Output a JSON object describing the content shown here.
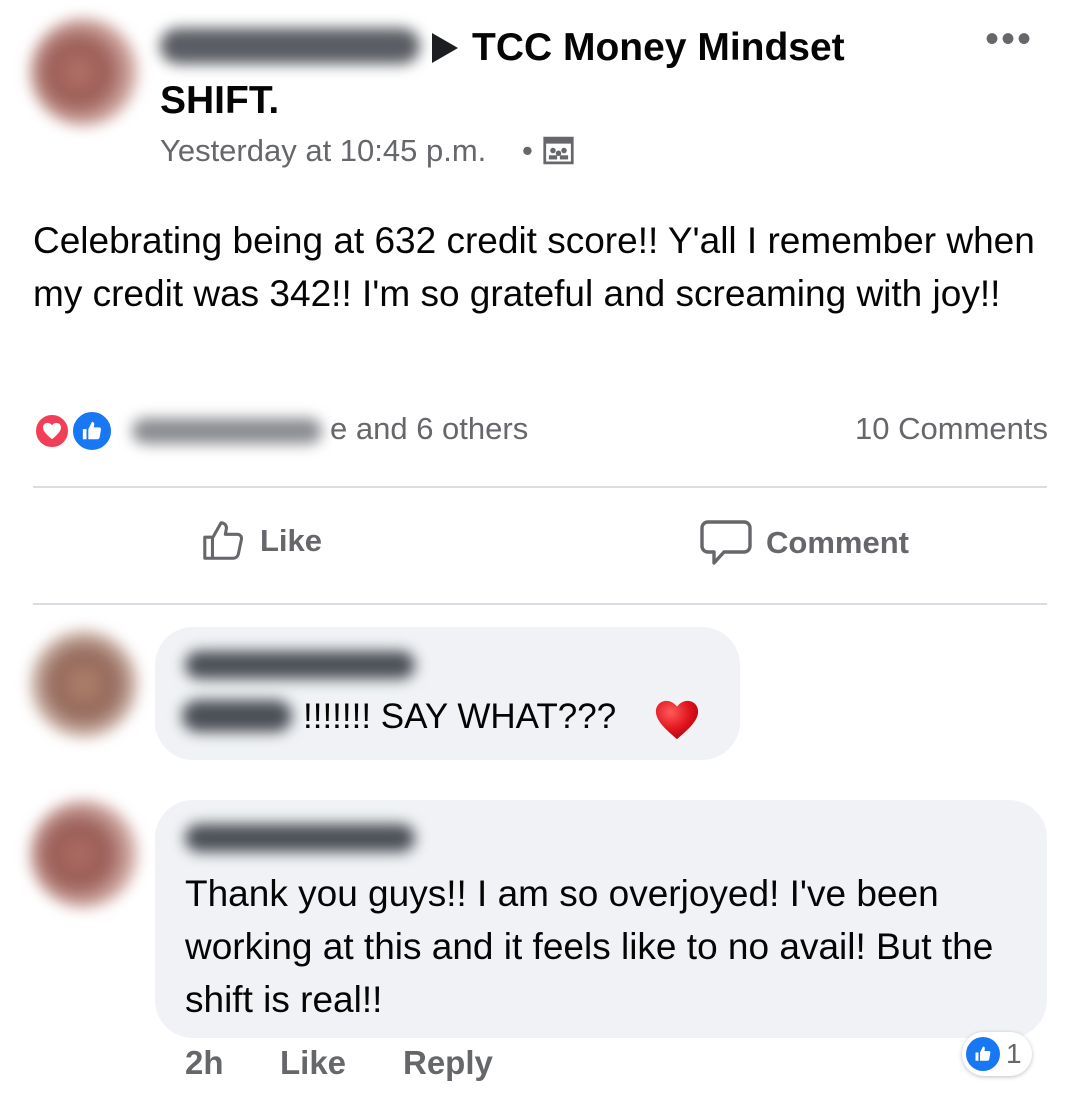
{
  "post": {
    "group_name_line1": "TCC Money Mindset",
    "group_name_line2": "SHIFT.",
    "timestamp": "Yesterday at 10:45 p.m.",
    "separator": "•",
    "more_icon": "more-options-icon",
    "text": "Celebrating being at 632 credit score!! Y'all I remember when my credit was 342!! I'm so grateful and screaming with joy!!"
  },
  "reactions": {
    "icons": [
      "love-reaction-icon",
      "like-reaction-icon"
    ],
    "summary": "e and 6 others",
    "comments_count": "10 Comments"
  },
  "actions": {
    "like_label": "Like",
    "comment_label": "Comment"
  },
  "comments": [
    {
      "text": "!!!!!!! SAY WHAT???",
      "emoji": "red-heart-icon"
    },
    {
      "text": "Thank you guys!! I am so overjoyed! I've been working at this and it feels like to no avail! But the shift is real!!",
      "time": "2h",
      "like_label": "Like",
      "reply_label": "Reply",
      "reaction_count": "1"
    }
  ],
  "colors": {
    "like_blue": "#1877f2",
    "love_red": "#f33e58",
    "secondary_text": "#65676b",
    "bubble_bg": "#f0f2f5"
  }
}
